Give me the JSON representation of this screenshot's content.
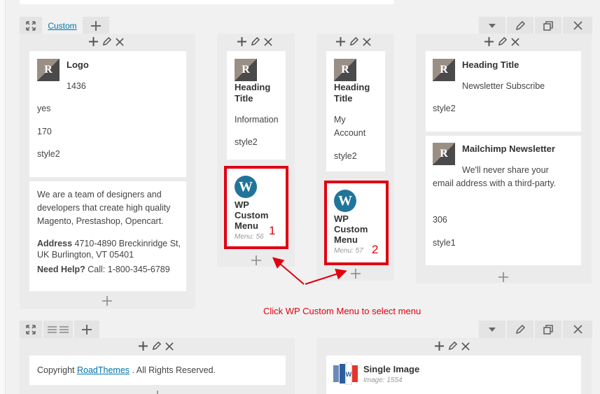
{
  "top_row": {
    "tab_label": "Custom"
  },
  "columns": {
    "col1": {
      "logo_widget": {
        "title": "Logo",
        "id": "1436",
        "lines": [
          "yes",
          "170",
          "style2"
        ]
      },
      "about": {
        "text": "We are a team of designers and developers that create high quality Magento, Prestashop, Opencart.",
        "address_label": "Address",
        "address_value": "4710-4890 Breckinridge St, UK Burlington, VT 05401",
        "help_label": "Need Help?",
        "help_value": "Call: 1-800-345-6789"
      }
    },
    "col2": {
      "heading": {
        "title": "Heading Title",
        "subtitle": "Information",
        "style": "style2"
      },
      "menu": {
        "title": "WP Custom Menu",
        "meta": "Menu: 56",
        "marker": "1"
      }
    },
    "col3": {
      "heading": {
        "title": "Heading Title",
        "subtitle": "My Account",
        "style": "style2"
      },
      "menu": {
        "title": "WP Custom Menu",
        "meta": "Menu: 57",
        "marker": "2"
      }
    },
    "col4": {
      "heading": {
        "title": "Heading Title",
        "subtitle": "Newsletter Subscribe",
        "style": "style2"
      },
      "mailchimp": {
        "title": "Mailchimp Newsletter",
        "text": "We'll never share your email address with a third-party.",
        "id": "306",
        "style": "style1"
      }
    }
  },
  "annotation": {
    "text": "Click WP Custom Menu to select menu"
  },
  "bottom_row": {
    "copyright_prefix": "Copyright ",
    "copyright_link": "RoadThemes",
    "copyright_suffix": " . All Rights Reserved.",
    "image_widget": {
      "title": "Single Image",
      "meta": "Image: 1554"
    }
  },
  "colors": {
    "accent_red": "#e0000f",
    "link_blue": "#0073aa",
    "wp_blue": "#21759b"
  },
  "icons": [
    "expand-icon",
    "plus-icon",
    "pencil-icon",
    "close-icon",
    "chevron-down-icon",
    "duplicate-icon",
    "columns-icon"
  ]
}
